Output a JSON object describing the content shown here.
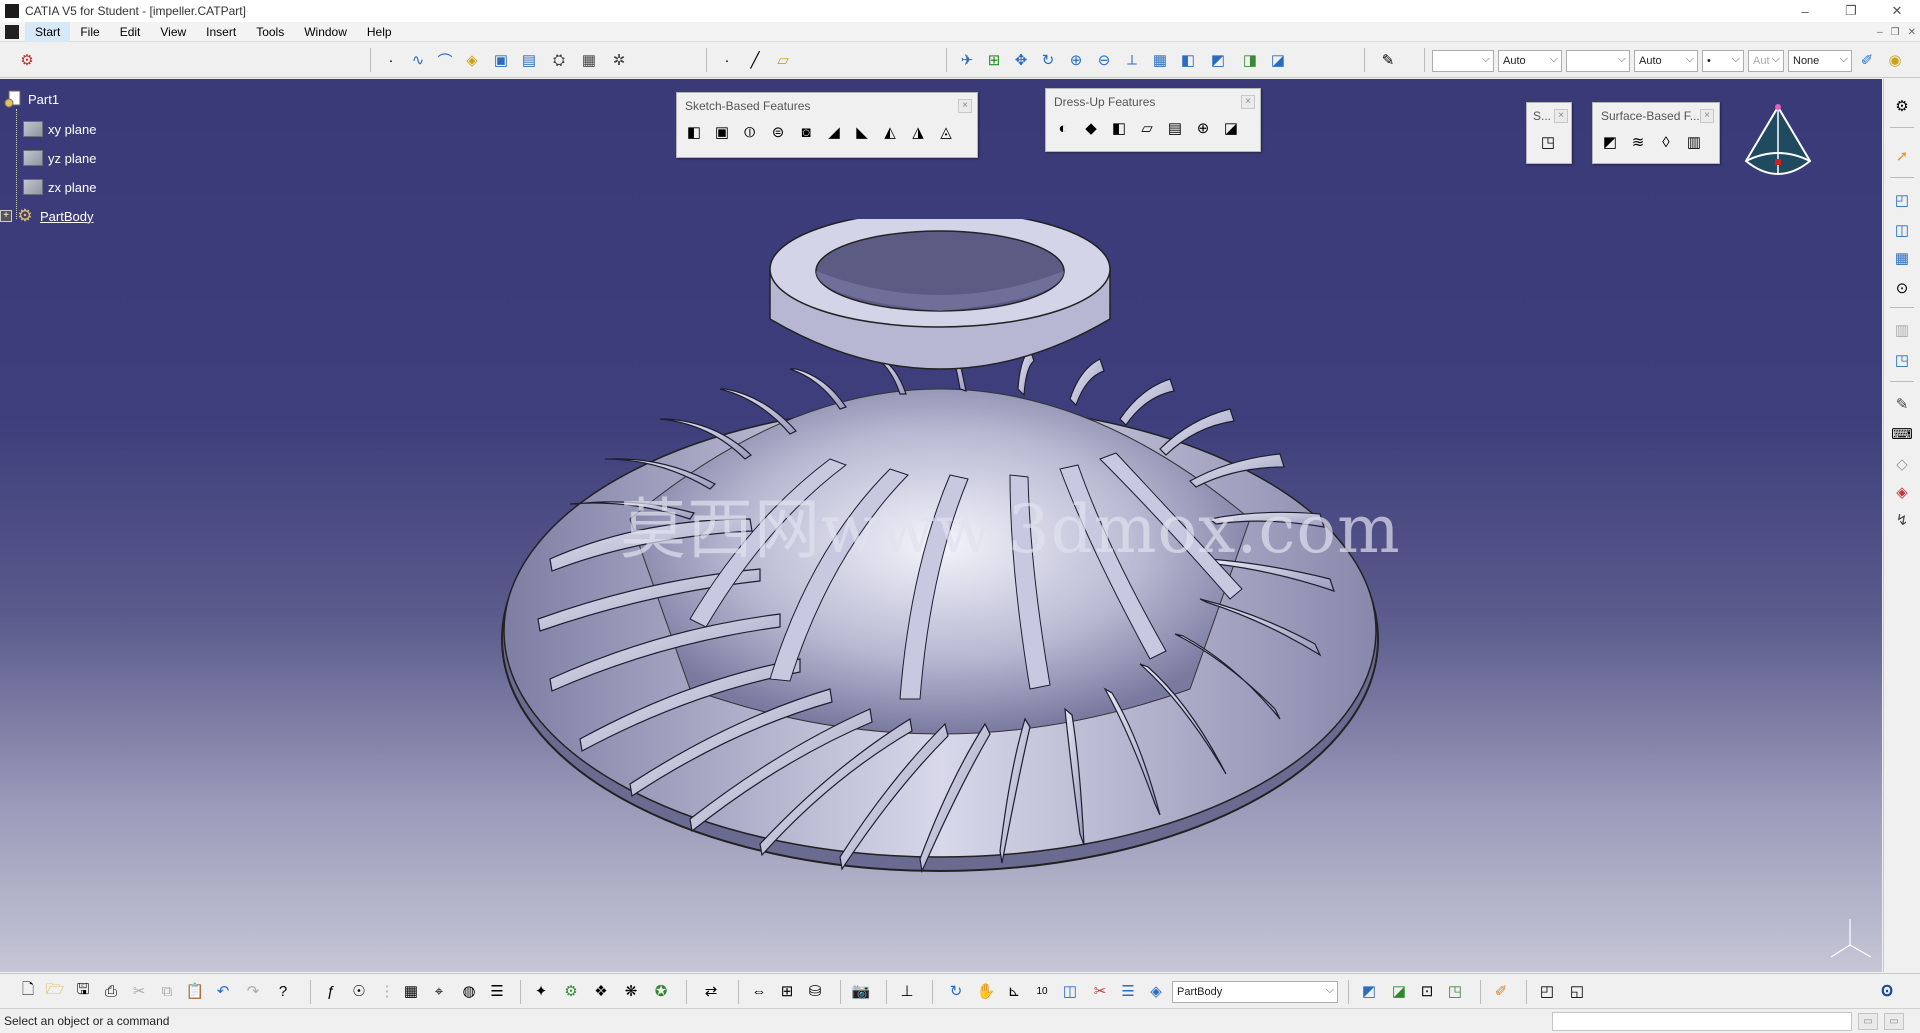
{
  "window": {
    "title": "CATIA V5 for Student - [impeller.CATPart]",
    "controls": [
      "–",
      "❐",
      "✕"
    ]
  },
  "menu": {
    "items": [
      "Start",
      "File",
      "Edit",
      "View",
      "Insert",
      "Tools",
      "Window",
      "Help"
    ],
    "mdi_controls": [
      "–",
      "❐",
      "✕"
    ]
  },
  "toolbar": {
    "line_thickness_combo": "",
    "color_combo": "Auto",
    "line_type_combo": "",
    "layer_combo": "Auto",
    "point_combo": "•",
    "auto_combo_3": "Aut",
    "render_combo": "None"
  },
  "tree": {
    "root": "Part1",
    "planes": [
      "xy plane",
      "yz plane",
      "zx plane"
    ],
    "body": "PartBody"
  },
  "floating_toolbars": {
    "sketch_based": "Sketch-Based Features",
    "dress_up": "Dress-Up Features",
    "small": "S...",
    "surface_based": "Surface-Based F..."
  },
  "watermark": "莫西网www.3dmox.com",
  "bottom_toolbar": {
    "body_selector": "PartBody"
  },
  "status": {
    "message": "Select an object or a command"
  }
}
